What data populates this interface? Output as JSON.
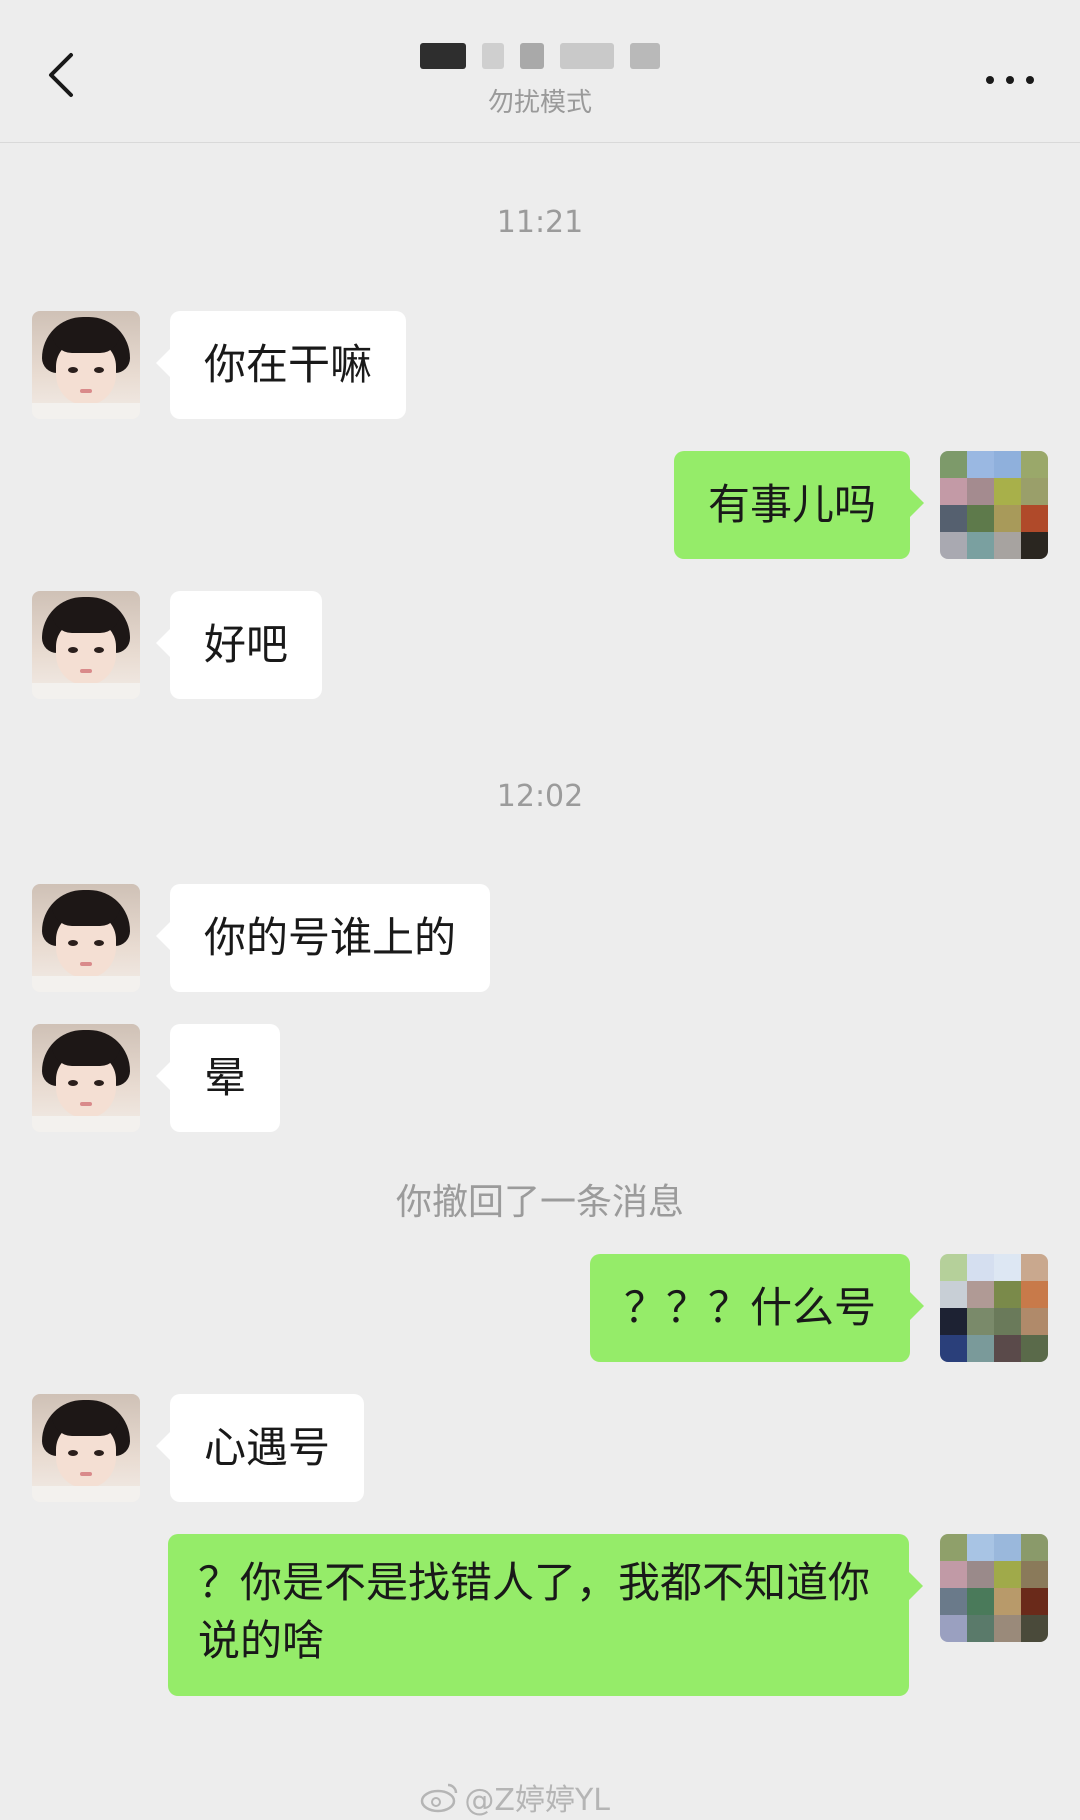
{
  "header": {
    "title": "",
    "subtitle": "勿扰模式",
    "back_icon": "chevron-left-icon",
    "more_icon": "more-dots-icon"
  },
  "messages": [
    {
      "type": "time",
      "text": "11:21"
    },
    {
      "type": "in",
      "text": "你在干嘛"
    },
    {
      "type": "out",
      "text": "有事儿吗"
    },
    {
      "type": "in",
      "text": "好吧"
    },
    {
      "type": "time",
      "text": "12:02"
    },
    {
      "type": "in",
      "text": "你的号谁上的"
    },
    {
      "type": "in",
      "text": "晕"
    },
    {
      "type": "system",
      "text": "你撤回了一条消息"
    },
    {
      "type": "out",
      "text": "？？？什么号"
    },
    {
      "type": "in",
      "text": "心遇号"
    },
    {
      "type": "out",
      "text": "？你是不是找错人了，我都不知道你说的啥"
    }
  ],
  "watermark": {
    "text": "@Z婷婷YL",
    "icon": "weibo-icon"
  },
  "colors": {
    "background": "#ededed",
    "incoming_bubble": "#ffffff",
    "outgoing_bubble": "#95ec69",
    "meta_text": "#9b9b9b"
  }
}
